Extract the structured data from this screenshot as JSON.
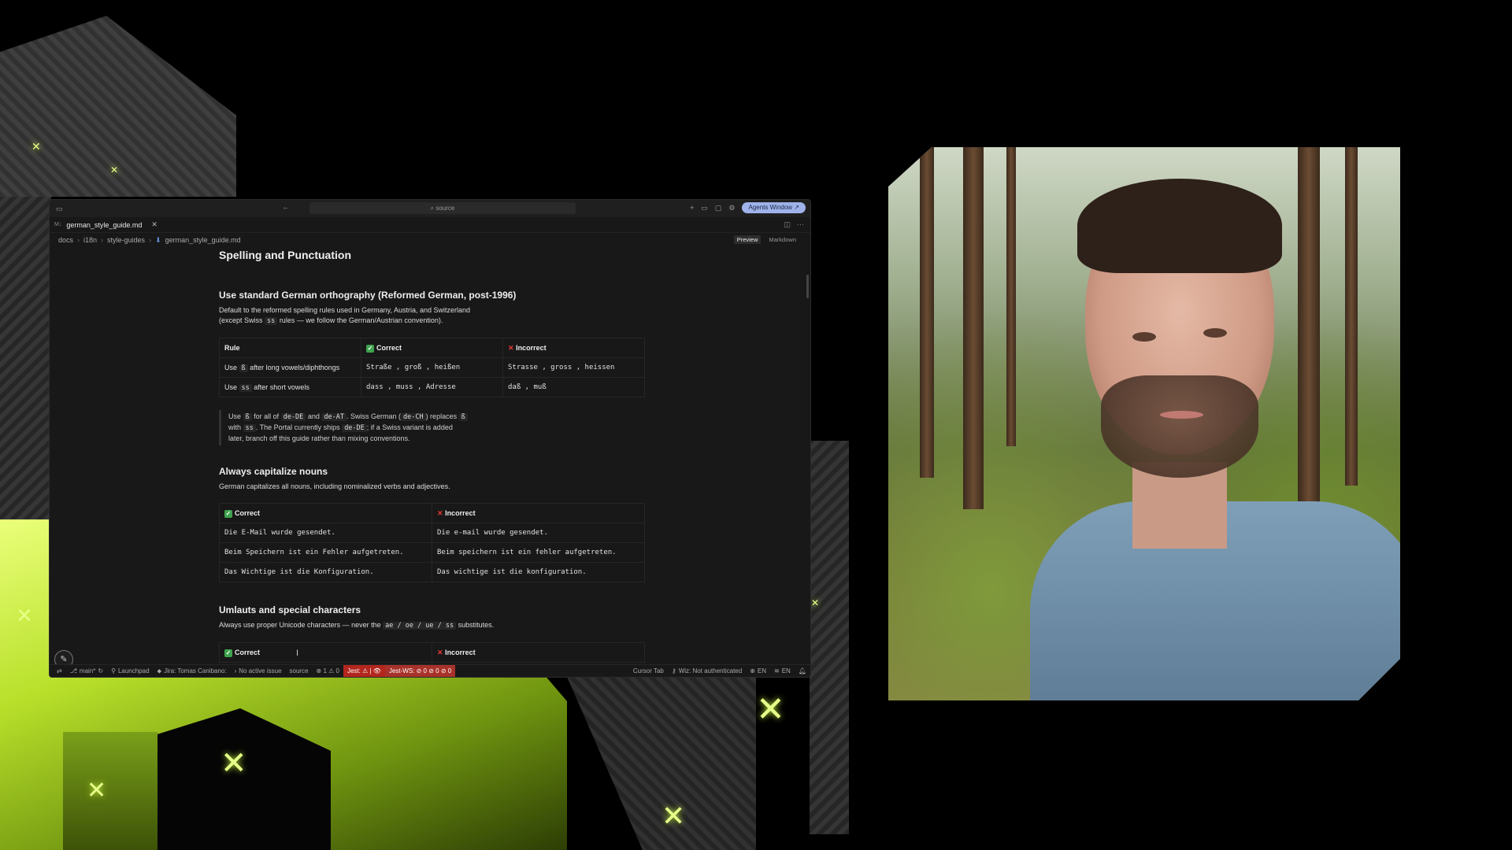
{
  "editor": {
    "search_text": "source",
    "agents_button": "Agents Window ↗",
    "tab_label": "german_style_guide.md",
    "breadcrumb": [
      "docs",
      "i18n",
      "style-guides",
      "german_style_guide.md"
    ],
    "mode_tabs": {
      "preview": "Preview",
      "markdown": "Markdown"
    }
  },
  "doc": {
    "h1": "Spelling and Punctuation",
    "section1": {
      "title": "Use standard German orthography (Reformed German, post-1996)",
      "intro_line1": "Default to the reformed spelling rules used in Germany, Austria, and Switzerland",
      "intro_line2_a": "(except Swiss",
      "intro_line2_code": "ss",
      "intro_line2_b": "rules — we follow the German/Austrian convention).",
      "table": {
        "headers": {
          "rule": "Rule",
          "correct": "Correct",
          "incorrect": "Incorrect"
        },
        "rows": [
          {
            "rule_a": "Use",
            "rule_code": "ß",
            "rule_b": "after long vowels/diphthongs",
            "correct": "Straße , groß , heißen",
            "incorrect": "Strasse , gross , heissen"
          },
          {
            "rule_a": "Use",
            "rule_code": "ss",
            "rule_b": "after short vowels",
            "correct": "dass , muss , Adresse",
            "incorrect": "daß , muß"
          }
        ]
      },
      "quote": {
        "p1": "Use",
        "c1": "ß",
        "p2": "for all of",
        "c2": "de-DE",
        "p3": "and",
        "c3": "de-AT",
        "p4": ". Swiss German (",
        "c4": "de-CH",
        "p5": ") replaces",
        "c5": "ß",
        "p6": "with",
        "c6": "ss",
        "p7": ". The Portal currently ships",
        "c7": "de-DE",
        "p8": "; if a Swiss variant is added",
        "line3": "later, branch off this guide rather than mixing conventions."
      }
    },
    "section2": {
      "title": "Always capitalize nouns",
      "intro": "German capitalizes all nouns, including nominalized verbs and adjectives.",
      "headers": {
        "correct": "Correct",
        "incorrect": "Incorrect"
      },
      "rows": [
        {
          "correct": "Die E-Mail wurde gesendet.",
          "incorrect": "Die e-mail wurde gesendet."
        },
        {
          "correct": "Beim Speichern ist ein Fehler aufgetreten.",
          "incorrect": "Beim speichern ist ein fehler aufgetreten."
        },
        {
          "correct": "Das Wichtige ist die Konfiguration.",
          "incorrect": "Das wichtige ist die konfiguration."
        }
      ]
    },
    "section3": {
      "title": "Umlauts and special characters",
      "intro_a": "Always use proper Unicode characters — never the",
      "intro_code": "ae / oe / ue / ss",
      "intro_b": "substitutes.",
      "headers": {
        "correct": "Correct",
        "incorrect": "Incorrect"
      }
    }
  },
  "statusbar": {
    "branch": "main*",
    "launchpad": "Launchpad",
    "jira": "Jira: Tomas Canibano:",
    "issue": "No active issue",
    "source": "source",
    "problems": "⊗ 1 ⚠ 0",
    "jest": "Jest: ⚠ | 👁",
    "jest_ws": "Jest-WS: ⊘ 0 ⊘ 0 ⊘ 0",
    "cursor_tab": "Cursor Tab",
    "wiz": "Wiz: Not authenticated",
    "lang1": "EN",
    "lang2": "EN"
  },
  "colors": {
    "accent_agents": "#9fb3ea",
    "jest_bg": "#b3261e",
    "lime": "#c7f03a"
  }
}
